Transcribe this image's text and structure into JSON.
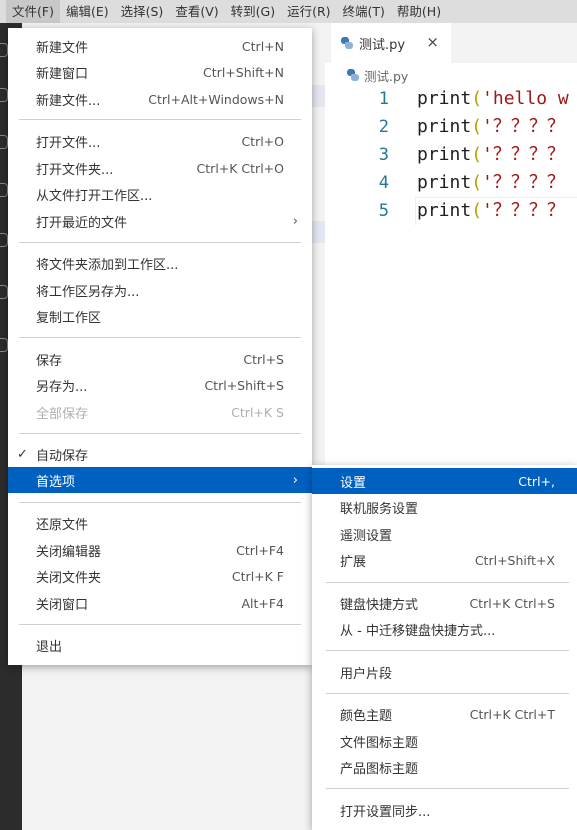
{
  "menubar": {
    "items": [
      "文件(F)",
      "编辑(E)",
      "选择(S)",
      "查看(V)",
      "转到(G)",
      "运行(R)",
      "终端(T)",
      "帮助(H)"
    ]
  },
  "editor": {
    "tab": {
      "label": "测试.py",
      "close": "×"
    },
    "breadcrumb": {
      "label": "测试.py"
    },
    "lines": [
      {
        "num": "1",
        "fn": "print",
        "open": "(",
        "text": "'hello w"
      },
      {
        "num": "2",
        "fn": "print",
        "open": "(",
        "text": "'？？？？"
      },
      {
        "num": "3",
        "fn": "print",
        "open": "(",
        "text": "'？？？？"
      },
      {
        "num": "4",
        "fn": "print",
        "open": "(",
        "text": "'？？？？"
      },
      {
        "num": "5",
        "fn": "print",
        "open": "(",
        "text": "'？？？？"
      }
    ]
  },
  "file_menu": {
    "items": [
      {
        "label": "新建文件",
        "shortcut": "Ctrl+N"
      },
      {
        "label": "新建窗口",
        "shortcut": "Ctrl+Shift+N"
      },
      {
        "label": "新建文件...",
        "shortcut": "Ctrl+Alt+Windows+N"
      },
      {
        "label": "打开文件...",
        "shortcut": "Ctrl+O"
      },
      {
        "label": "打开文件夹...",
        "shortcut": "Ctrl+K Ctrl+O"
      },
      {
        "label": "从文件打开工作区...",
        "shortcut": ""
      },
      {
        "label": "打开最近的文件",
        "shortcut": ""
      },
      {
        "label": "将文件夹添加到工作区...",
        "shortcut": ""
      },
      {
        "label": "将工作区另存为...",
        "shortcut": ""
      },
      {
        "label": "复制工作区",
        "shortcut": ""
      },
      {
        "label": "保存",
        "shortcut": "Ctrl+S"
      },
      {
        "label": "另存为...",
        "shortcut": "Ctrl+Shift+S"
      },
      {
        "label": "全部保存",
        "shortcut": "Ctrl+K S"
      },
      {
        "label": "自动保存",
        "shortcut": ""
      },
      {
        "label": "首选项",
        "shortcut": ""
      },
      {
        "label": "还原文件",
        "shortcut": ""
      },
      {
        "label": "关闭编辑器",
        "shortcut": "Ctrl+F4"
      },
      {
        "label": "关闭文件夹",
        "shortcut": "Ctrl+K F"
      },
      {
        "label": "关闭窗口",
        "shortcut": "Alt+F4"
      },
      {
        "label": "退出",
        "shortcut": ""
      }
    ],
    "checkmark": "✓",
    "submenu_arrow": "›"
  },
  "pref_menu": {
    "items": [
      {
        "label": "设置",
        "shortcut": "Ctrl+,"
      },
      {
        "label": "联机服务设置",
        "shortcut": ""
      },
      {
        "label": "遥测设置",
        "shortcut": ""
      },
      {
        "label": "扩展",
        "shortcut": "Ctrl+Shift+X"
      },
      {
        "label": "键盘快捷方式",
        "shortcut": "Ctrl+K Ctrl+S"
      },
      {
        "label": "从 - 中迁移键盘快捷方式...",
        "shortcut": ""
      },
      {
        "label": "用户片段",
        "shortcut": ""
      },
      {
        "label": "颜色主题",
        "shortcut": "Ctrl+K Ctrl+T"
      },
      {
        "label": "文件图标主题",
        "shortcut": ""
      },
      {
        "label": "产品图标主题",
        "shortcut": ""
      },
      {
        "label": "打开设置同步...",
        "shortcut": ""
      }
    ]
  },
  "colors": {
    "menubar_bg": "#dddddd",
    "activity_bg": "#2c2c2c",
    "highlight": "#0060c0",
    "string": "#a31515",
    "line_number": "#237893"
  }
}
